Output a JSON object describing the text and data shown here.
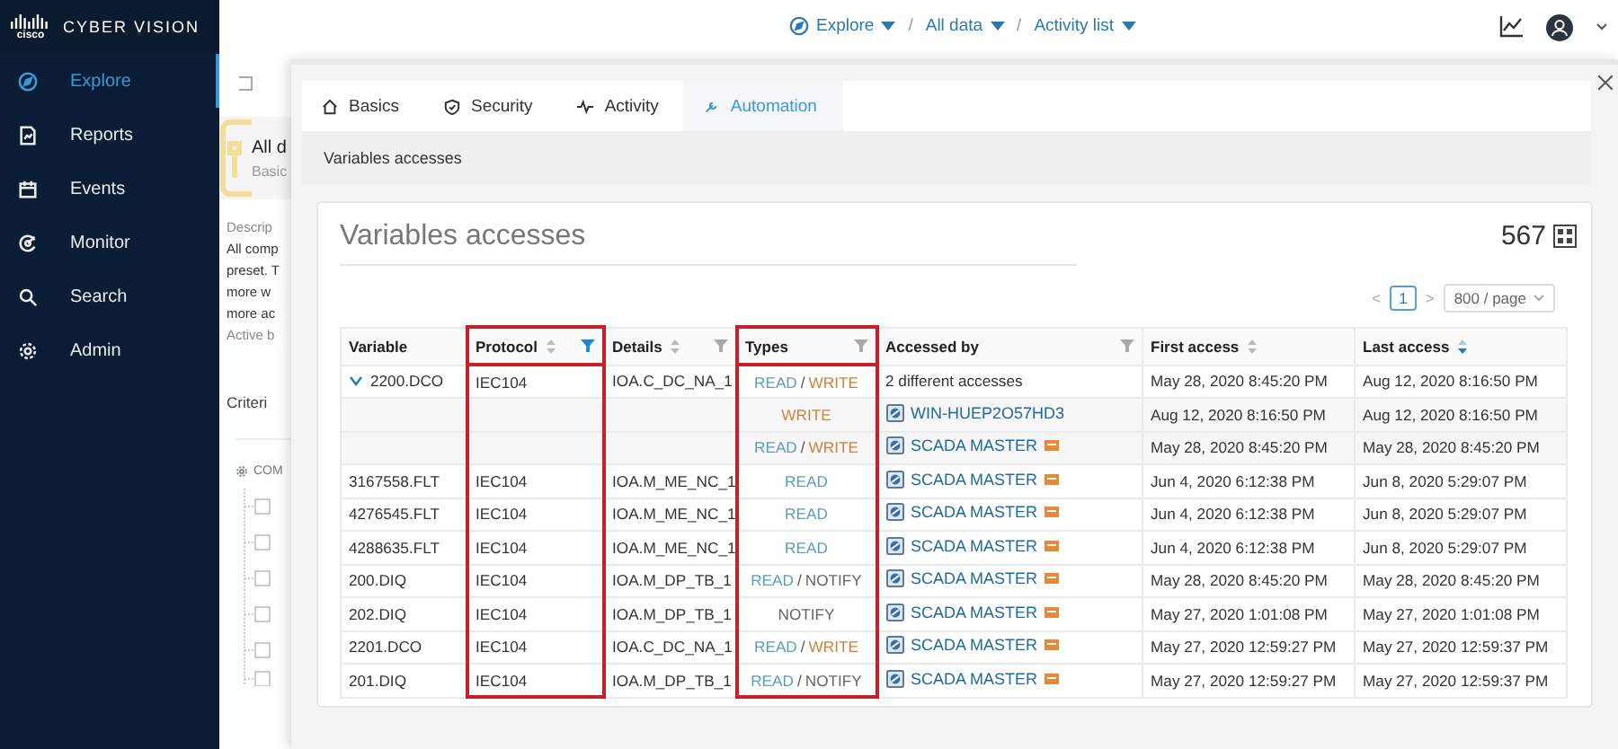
{
  "sidebar": {
    "brand": "cisco",
    "product": "CYBER VISION",
    "items": [
      {
        "label": "Explore",
        "selected": true
      },
      {
        "label": "Reports",
        "selected": false
      },
      {
        "label": "Events",
        "selected": false
      },
      {
        "label": "Monitor",
        "selected": false
      },
      {
        "label": "Search",
        "selected": false
      },
      {
        "label": "Admin",
        "selected": false
      }
    ]
  },
  "breadcrumb": [
    {
      "label": "Explore"
    },
    {
      "label": "All data"
    },
    {
      "label": "Activity list"
    }
  ],
  "breadcrumb_separator": "/",
  "background_page": {
    "title": "All d",
    "subtitle": "Basic",
    "description_label": "Descrip",
    "description_lines": [
      "All comp",
      "preset. T",
      "more w",
      "more ac"
    ],
    "footnote": "Active b",
    "criteria": "Criteri",
    "components": "COM"
  },
  "drawer": {
    "tabs": [
      {
        "label": "Basics",
        "selected": false
      },
      {
        "label": "Security",
        "selected": false
      },
      {
        "label": "Activity",
        "selected": false
      },
      {
        "label": "Automation",
        "selected": true
      }
    ],
    "section": "Variables accesses",
    "card": {
      "title": "Variables accesses",
      "count": "567",
      "pagination": {
        "prev": "<",
        "page": "1",
        "next": ">",
        "page_size": "800 / page"
      },
      "type_separator": "/",
      "columns": [
        {
          "label": "Variable",
          "sortable": false,
          "sort_active": false,
          "filterable": false,
          "filter_active": false,
          "highlighted": false
        },
        {
          "label": "Protocol",
          "sortable": true,
          "sort_active": false,
          "filterable": true,
          "filter_active": true,
          "highlighted": true
        },
        {
          "label": "Details",
          "sortable": true,
          "sort_active": false,
          "filterable": true,
          "filter_active": false,
          "highlighted": false
        },
        {
          "label": "Types",
          "sortable": false,
          "sort_active": false,
          "filterable": true,
          "filter_active": false,
          "highlighted": true
        },
        {
          "label": "Accessed by",
          "sortable": false,
          "sort_active": false,
          "filterable": true,
          "filter_active": false,
          "highlighted": false
        },
        {
          "label": "First access",
          "sortable": true,
          "sort_active": false,
          "filterable": false,
          "filter_active": false,
          "highlighted": false
        },
        {
          "label": "Last access",
          "sortable": true,
          "sort_active": true,
          "filterable": false,
          "filter_active": false,
          "highlighted": false
        }
      ],
      "rows": [
        {
          "kind": "parent",
          "expanded": true,
          "variable": "2200.DCO",
          "protocol": "IEC104",
          "details": "IOA.C_DC_NA_1",
          "types": [
            {
              "label": "READ",
              "kind": "read"
            },
            {
              "label": "WRITE",
              "kind": "write"
            }
          ],
          "accessed_by": {
            "kind": "text",
            "label": "2 different accesses",
            "badge": false
          },
          "first_access": "May 28, 2020 8:45:20 PM",
          "last_access": "Aug 12, 2020 8:16:50 PM"
        },
        {
          "kind": "child",
          "types": [
            {
              "label": "WRITE",
              "kind": "write"
            }
          ],
          "accessed_by": {
            "kind": "device",
            "label": "WIN-HUEP2O57HD3",
            "badge": false
          },
          "first_access": "Aug 12, 2020 8:16:50 PM",
          "last_access": "Aug 12, 2020 8:16:50 PM"
        },
        {
          "kind": "child",
          "types": [
            {
              "label": "READ",
              "kind": "read"
            },
            {
              "label": "WRITE",
              "kind": "write"
            }
          ],
          "accessed_by": {
            "kind": "device",
            "label": "SCADA MASTER",
            "badge": true
          },
          "first_access": "May 28, 2020 8:45:20 PM",
          "last_access": "May 28, 2020 8:45:20 PM"
        },
        {
          "kind": "plain",
          "variable": "3167558.FLT",
          "protocol": "IEC104",
          "details": "IOA.M_ME_NC_1",
          "types": [
            {
              "label": "READ",
              "kind": "read"
            }
          ],
          "accessed_by": {
            "kind": "device",
            "label": "SCADA MASTER",
            "badge": true
          },
          "first_access": "Jun 4, 2020 6:12:38 PM",
          "last_access": "Jun 8, 2020 5:29:07 PM"
        },
        {
          "kind": "plain",
          "variable": "4276545.FLT",
          "protocol": "IEC104",
          "details": "IOA.M_ME_NC_1",
          "types": [
            {
              "label": "READ",
              "kind": "read"
            }
          ],
          "accessed_by": {
            "kind": "device",
            "label": "SCADA MASTER",
            "badge": true
          },
          "first_access": "Jun 4, 2020 6:12:38 PM",
          "last_access": "Jun 8, 2020 5:29:07 PM"
        },
        {
          "kind": "plain",
          "variable": "4288635.FLT",
          "protocol": "IEC104",
          "details": "IOA.M_ME_NC_1",
          "types": [
            {
              "label": "READ",
              "kind": "read"
            }
          ],
          "accessed_by": {
            "kind": "device",
            "label": "SCADA MASTER",
            "badge": true
          },
          "first_access": "Jun 4, 2020 6:12:38 PM",
          "last_access": "Jun 8, 2020 5:29:07 PM"
        },
        {
          "kind": "plain",
          "variable": "200.DIQ",
          "protocol": "IEC104",
          "details": "IOA.M_DP_TB_1",
          "types": [
            {
              "label": "READ",
              "kind": "read"
            },
            {
              "label": "NOTIFY",
              "kind": "notify"
            }
          ],
          "accessed_by": {
            "kind": "device",
            "label": "SCADA MASTER",
            "badge": true
          },
          "first_access": "May 28, 2020 8:45:20 PM",
          "last_access": "May 28, 2020 8:45:20 PM"
        },
        {
          "kind": "plain",
          "variable": "202.DIQ",
          "protocol": "IEC104",
          "details": "IOA.M_DP_TB_1",
          "types": [
            {
              "label": "NOTIFY",
              "kind": "notify"
            }
          ],
          "accessed_by": {
            "kind": "device",
            "label": "SCADA MASTER",
            "badge": true
          },
          "first_access": "May 27, 2020 1:01:08 PM",
          "last_access": "May 27, 2020 1:01:08 PM"
        },
        {
          "kind": "plain",
          "variable": "2201.DCO",
          "protocol": "IEC104",
          "details": "IOA.C_DC_NA_1",
          "types": [
            {
              "label": "READ",
              "kind": "read"
            },
            {
              "label": "WRITE",
              "kind": "write"
            }
          ],
          "accessed_by": {
            "kind": "device",
            "label": "SCADA MASTER",
            "badge": true
          },
          "first_access": "May 27, 2020 12:59:27 PM",
          "last_access": "May 27, 2020 12:59:37 PM"
        },
        {
          "kind": "plain",
          "variable": "201.DIQ",
          "protocol": "IEC104",
          "details": "IOA.M_DP_TB_1",
          "types": [
            {
              "label": "READ",
              "kind": "read"
            },
            {
              "label": "NOTIFY",
              "kind": "notify"
            }
          ],
          "accessed_by": {
            "kind": "device",
            "label": "SCADA MASTER",
            "badge": true
          },
          "first_access": "May 27, 2020 12:59:27 PM",
          "last_access": "May 27, 2020 12:59:37 PM"
        }
      ]
    }
  }
}
